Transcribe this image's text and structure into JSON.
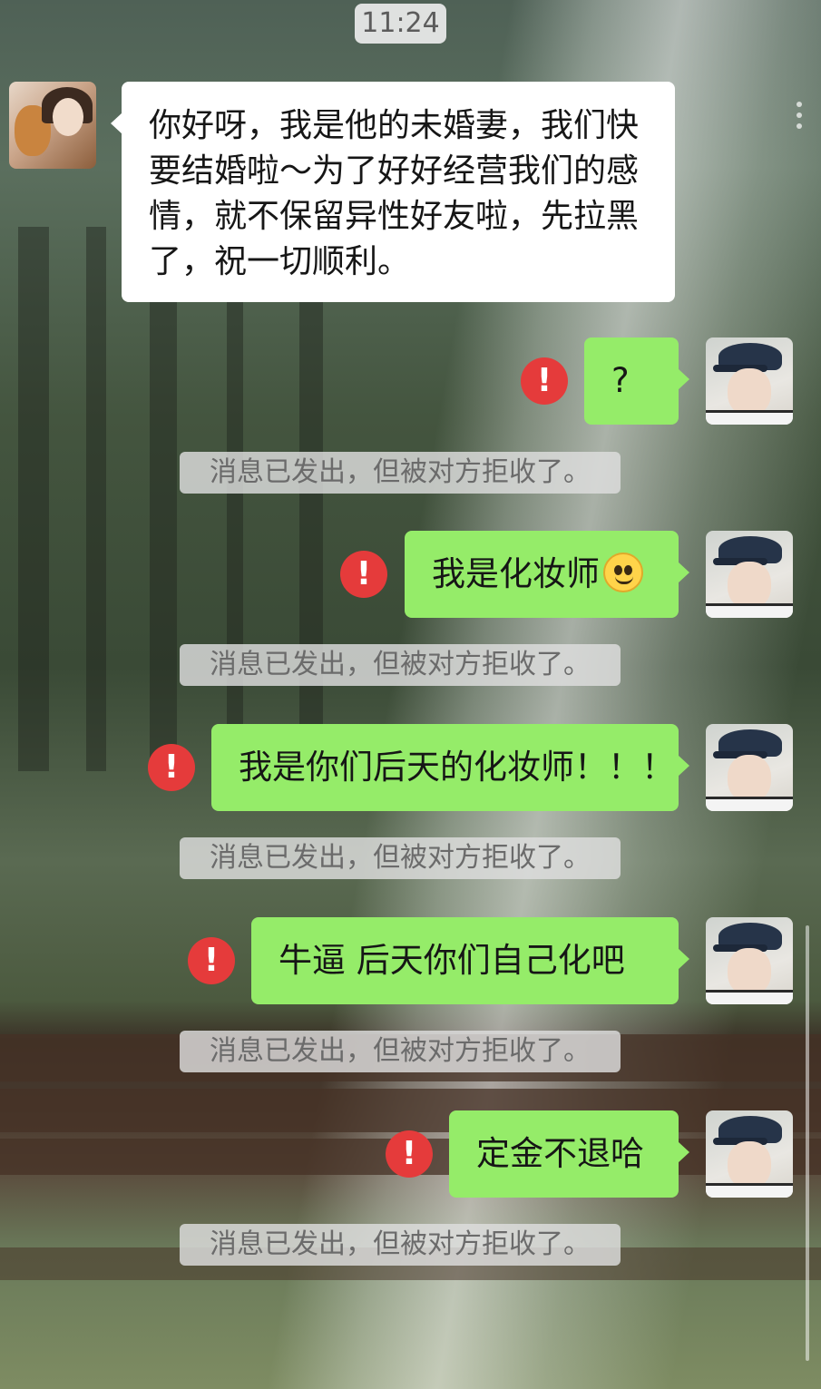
{
  "status": {
    "time": "11:24"
  },
  "messages": {
    "incoming": {
      "text": "你好呀，我是他的未婚妻，我们快要结婚啦～为了好好经营我们的感情，就不保留异性好友啦，先拉黑了，祝一切顺利。"
    },
    "outgoing": [
      {
        "text": "?",
        "notice": "消息已发出，但被对方拒收了。",
        "error_icon": "!"
      },
      {
        "text": "我是化妆师",
        "emoji": "smiley-emoji",
        "notice": "消息已发出，但被对方拒收了。",
        "error_icon": "!"
      },
      {
        "text": "我是你们后天的化妆师！！！",
        "notice": "消息已发出，但被对方拒收了。",
        "error_icon": "!"
      },
      {
        "text": "牛逼 后天你们自己化吧",
        "notice": "消息已发出，但被对方拒收了。",
        "error_icon": "!"
      },
      {
        "text": "定金不退哈",
        "notice": "消息已发出，但被对方拒收了。",
        "error_icon": "!"
      }
    ]
  },
  "colors": {
    "outgoing_bubble": "#95ec69",
    "incoming_bubble": "#ffffff",
    "error_badge": "#e53b3b",
    "notice_bg": "#dedede"
  }
}
